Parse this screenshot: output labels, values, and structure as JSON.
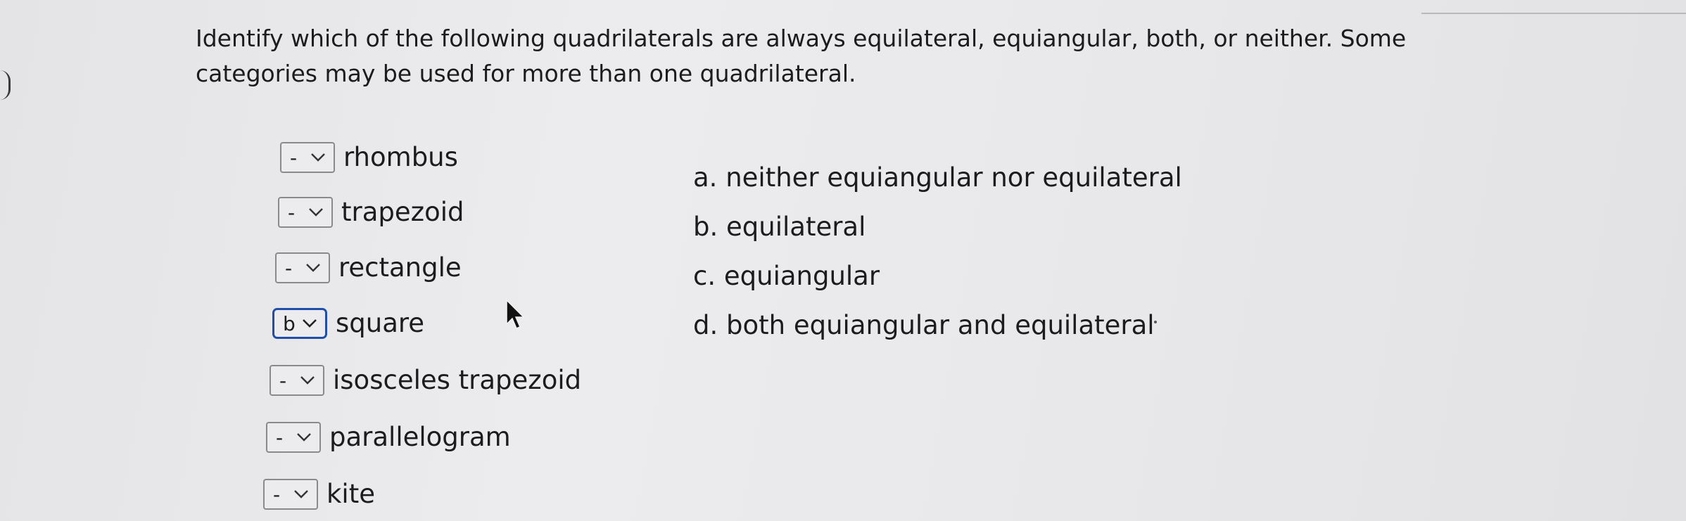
{
  "question": "Identify which of the following quadrilaterals are always equilateral, equiangular, both, or neither. Some categories may be used for more than one quadrilateral.",
  "items": [
    {
      "select_value": "-",
      "label": "rhombus"
    },
    {
      "select_value": "-",
      "label": "trapezoid"
    },
    {
      "select_value": "-",
      "label": "rectangle"
    },
    {
      "select_value": "b",
      "label": "square"
    },
    {
      "select_value": "-",
      "label": "isosceles trapezoid"
    },
    {
      "select_value": "-",
      "label": "parallelogram"
    },
    {
      "select_value": "-",
      "label": "kite"
    }
  ],
  "options": [
    "a. neither equiangular nor equilateral",
    "b. equilateral",
    "c. equiangular",
    "d. both equiangular and equilateral"
  ],
  "colors": {
    "focus_border": "#1f4fa8",
    "text": "#1c1c1e",
    "dropdown_border": "#8a8a8e"
  }
}
